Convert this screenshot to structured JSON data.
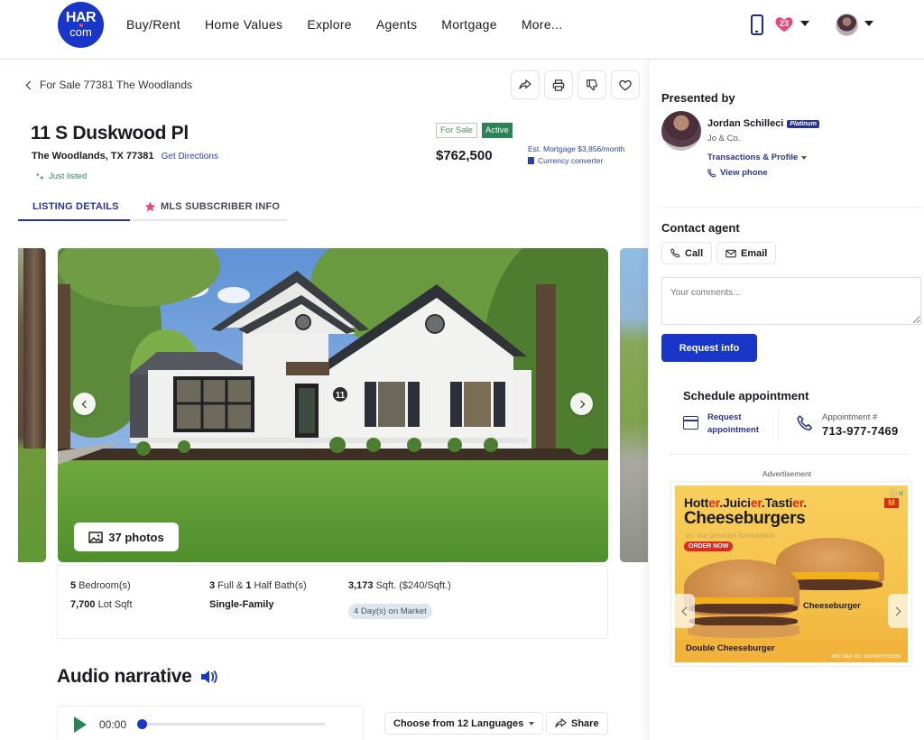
{
  "header": {
    "logo_top": "HAR",
    "logo_bottom": "com",
    "nav": [
      "Buy/Rent",
      "Home Values",
      "Explore",
      "Agents",
      "Mortgage",
      "More..."
    ],
    "favorites_count": "23",
    "icons": [
      "mobile-phone-icon",
      "heart-icon",
      "chevron-down-icon",
      "avatar"
    ]
  },
  "listing": {
    "breadcrumb": "For Sale 77381 The Woodlands",
    "actions": [
      "share-icon",
      "print-icon",
      "thumbs-down-icon",
      "heart-icon"
    ],
    "title": "11 S Duskwood Pl",
    "address": "The Woodlands, TX 77381",
    "directions_link": "Get Directions",
    "just_listed": "Just listed",
    "status_forsale": "For Sale",
    "status_active": "Active",
    "price": "$762,500",
    "mortgage": "Est. Mortgage $3,856/month",
    "currency": "Currency converter",
    "tabs": [
      {
        "label": "LISTING DETAILS",
        "active": true
      },
      {
        "label": "MLS SUBSCRIBER INFO",
        "active": false
      }
    ],
    "photos_label": "37 photos",
    "facts": {
      "bedrooms_num": "5",
      "bedrooms_label": " Bedroom(s)",
      "lot_num": "7,700",
      "lot_label": " Lot Sqft",
      "full_bath": "3",
      "bath_mid": " Full & ",
      "half_bath": "1",
      "bath_label": " Half Bath(s)",
      "type": "Single-Family",
      "sqft_num": "3,173",
      "sqft_label": " Sqft. ($240/Sqft.)",
      "days_on_market": "4 Day(s) on Market"
    },
    "audio": {
      "title": "Audio narrative",
      "time": "00:00",
      "progress": 0,
      "languages_button": "Choose from 12 Languages",
      "share_button": "Share"
    }
  },
  "sidebar": {
    "presented_by": "Presented by",
    "agent_name": "Jordan Schilleci",
    "agent_tier": "Platinum",
    "agent_company": "Jo & Co.",
    "transactions_link": "Transactions & Profile",
    "view_phone": "View phone",
    "contact_heading": "Contact agent",
    "call_button": "Call",
    "email_button": "Email",
    "comments_placeholder": "Your comments...",
    "request_button": "Request info",
    "schedule_heading": "Schedule appointment",
    "request_appt_line1": "Request",
    "request_appt_line2": "appointment",
    "appt_label": "Appointment #",
    "appt_number": "713-977-7469",
    "ad_label": "Advertisement",
    "ad": {
      "line1_parts": [
        "Hott",
        "er",
        ".Juici",
        "er",
        ".Tasti",
        "er",
        "."
      ],
      "line2": "Cheeseburgers",
      "line3": "vs. our previous formulation",
      "cta": "ORDER NOW",
      "item1": "Cheeseburger",
      "item2": "Double Cheeseburger",
      "ref": "ABC REF NO. 00070P0753OM"
    }
  },
  "colors": {
    "brand_blue": "#1a36c8",
    "link_navy": "#2a3591",
    "active_green": "#2e8259",
    "fav_pink": "#e34b7a"
  }
}
